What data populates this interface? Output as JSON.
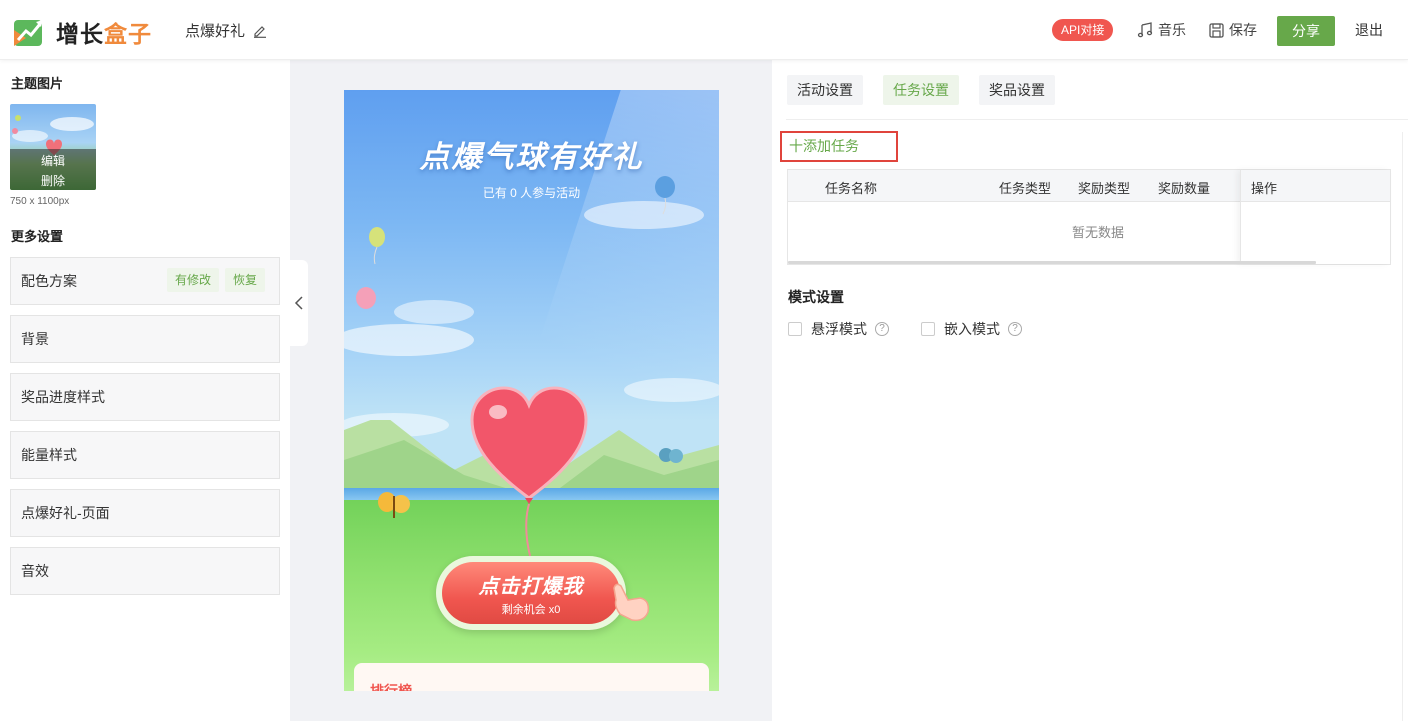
{
  "app": {
    "logo_text_part1": "增长",
    "logo_text_part2": "盒子",
    "doc_title": "点爆好礼",
    "api_badge": "API对接",
    "music": "音乐",
    "save": "保存",
    "share": "分享",
    "exit": "退出"
  },
  "left_panel": {
    "theme_image_title": "主题图片",
    "thumb_edit": "编辑",
    "thumb_delete": "删除",
    "thumb_size": "750 x 1100px",
    "more_settings_title": "更多设置",
    "items": [
      {
        "label": "配色方案",
        "tags": [
          "有修改",
          "恢复"
        ]
      },
      {
        "label": "背景"
      },
      {
        "label": "奖品进度样式"
      },
      {
        "label": "能量样式"
      },
      {
        "label": "点爆好礼-页面"
      },
      {
        "label": "音效"
      }
    ]
  },
  "preview": {
    "title": "点爆气球有好礼",
    "subtitle": "已有 0 人参与活动",
    "cta_main": "点击打爆我",
    "cta_sub": "剩余机会 x0",
    "rank_title": "排行榜"
  },
  "right_panel": {
    "tabs": [
      {
        "label": "活动设置",
        "active": false
      },
      {
        "label": "任务设置",
        "active": true
      },
      {
        "label": "奖品设置",
        "active": false
      }
    ],
    "add_task": "十添加任务",
    "table_headers": [
      "任务名称",
      "任务类型",
      "奖励类型",
      "奖励数量",
      "操作"
    ],
    "empty_text": "暂无数据",
    "mode_title": "模式设置",
    "mode_options": [
      "悬浮模式",
      "嵌入模式"
    ]
  },
  "colors": {
    "accent_green": "#67a84a",
    "api_red": "#f0564f",
    "highlight_red": "#e0443c",
    "logo_orange": "#f08a3c"
  }
}
